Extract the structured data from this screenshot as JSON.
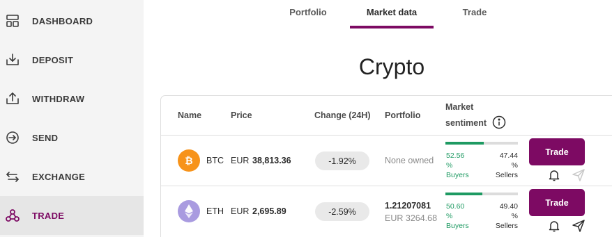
{
  "sidebar": {
    "items": [
      {
        "label": "DASHBOARD",
        "icon": "dashboard-icon"
      },
      {
        "label": "DEPOSIT",
        "icon": "deposit-icon"
      },
      {
        "label": "WITHDRAW",
        "icon": "withdraw-icon"
      },
      {
        "label": "SEND",
        "icon": "send-icon"
      },
      {
        "label": "EXCHANGE",
        "icon": "exchange-icon"
      },
      {
        "label": "TRADE",
        "icon": "trade-icon",
        "active": true
      }
    ]
  },
  "tabs": [
    {
      "label": "Portfolio"
    },
    {
      "label": "Market data",
      "active": true
    },
    {
      "label": "Trade"
    }
  ],
  "page_title": "Crypto",
  "table": {
    "headers": {
      "name": "Name",
      "price": "Price",
      "change": "Change (24H)",
      "portfolio": "Portfolio",
      "sentiment_line1": "Market",
      "sentiment_line2": "sentiment"
    },
    "rows": [
      {
        "symbol": "BTC",
        "icon": "bitcoin-icon",
        "price_currency": "EUR",
        "price_value": "38,813.36",
        "change": "-1.92%",
        "portfolio_primary": "None owned",
        "portfolio_secondary": "",
        "buyers_pct": "52.56",
        "buyers_pct_sign": "%",
        "buyers_label": "Buyers",
        "sellers_pct": "47.44",
        "sellers_pct_sign": "%",
        "sellers_label": "Sellers",
        "buyers_fraction": 0.5256,
        "trade_label": "Trade",
        "send_enabled": false
      },
      {
        "symbol": "ETH",
        "icon": "ethereum-icon",
        "price_currency": "EUR",
        "price_value": "2,695.89",
        "change": "-2.59%",
        "portfolio_primary": "1.21207081",
        "portfolio_secondary": "EUR 3264.68",
        "buyers_pct": "50.60",
        "buyers_pct_sign": "%",
        "buyers_label": "Buyers",
        "sellers_pct": "49.40",
        "sellers_pct_sign": "%",
        "sellers_label": "Sellers",
        "buyers_fraction": 0.506,
        "trade_label": "Trade",
        "send_enabled": true
      }
    ]
  },
  "colors": {
    "brand": "#7d0a63",
    "buyers": "#1e9a62",
    "bitcoin": "#f7931a",
    "ethereum": "#a99be0"
  }
}
